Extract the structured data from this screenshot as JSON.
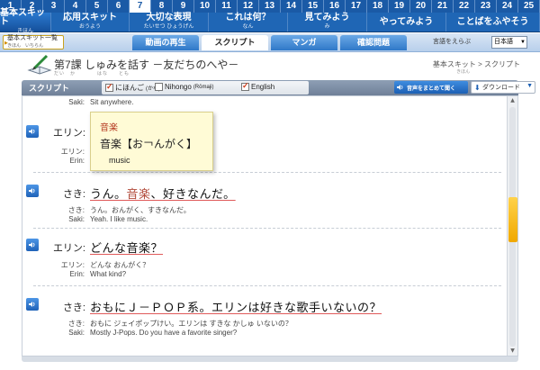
{
  "lesson_numbers": [
    "1",
    "2",
    "3",
    "4",
    "5",
    "6",
    "7",
    "8",
    "9",
    "10",
    "11",
    "12",
    "13",
    "14",
    "15",
    "16",
    "17",
    "18",
    "19",
    "20",
    "21",
    "22",
    "23",
    "24",
    "25"
  ],
  "active_lesson": "7",
  "categories": [
    {
      "label": "基本スキット",
      "sub": "きほん"
    },
    {
      "label": "応用スキット",
      "sub": "おうよう"
    },
    {
      "label": "大切な表現",
      "sub": "たいせつ ひょうげん"
    },
    {
      "label": "これは何？",
      "sub": "なん"
    },
    {
      "label": "見てみよう",
      "sub": "み"
    },
    {
      "label": "やってみよう",
      "sub": ""
    },
    {
      "label": "ことばをふやそう",
      "sub": ""
    }
  ],
  "subnav": {
    "back_label": "基本スキット一覧",
    "back_sub": "きほん　いちらん",
    "tabs": [
      {
        "label": "動画の再生"
      },
      {
        "label": "スクリプト"
      },
      {
        "label": "マンガ"
      },
      {
        "label": "確認問題"
      }
    ],
    "lang_label": "言語をえらぶ",
    "lang_value": "日本語"
  },
  "lesson": {
    "title": "第7課 しゅみを話す －友だちのへや－",
    "ruby": "だい　か　　　　はな　　とも",
    "breadcrumb": "基本スキット > スクリプト",
    "breadcrumb_ruby": "きほん"
  },
  "toolbar": {
    "label": "スクリプト",
    "check1": "にほんご",
    "check1_sub": "(かな)",
    "check2": "Nihongo",
    "check2_sub": "(Rōmaji)",
    "check3": "English",
    "audio_all": "音声をまとめて聞く",
    "download": "ダウンロード"
  },
  "script": {
    "partial_top": {
      "speaker": "Saki:",
      "text": "Sit anywhere."
    },
    "lines": [
      {
        "speaker": "エリン:",
        "text": "",
        "sub_speaker": "エリン:",
        "sub_text": "",
        "en_speaker": "Erin:",
        "en_text": ""
      },
      {
        "speaker": "さき:",
        "text_pre": "うん。",
        "text_hl": "音楽",
        "text_post": "、好きなんだ。",
        "sub_speaker": "さき:",
        "sub_text": "うん。おんがく、すきなんだ。",
        "en_speaker": "Saki:",
        "en_text": "Yeah. I like music."
      },
      {
        "speaker": "エリン:",
        "text": "どんな音楽？",
        "sub_speaker": "エリン:",
        "sub_text": "どんな おんがく？",
        "en_speaker": "Erin:",
        "en_text": "What kind?"
      },
      {
        "speaker": "さき:",
        "text": "おもにＪ－ＰＯＰ系。エリンは好きな歌手いないの？",
        "sub_speaker": "さき:",
        "sub_text": "おもに ジェイポップけい。エリンは すきな かしゅ いないの？",
        "en_speaker": "Saki:",
        "en_text": "Mostly J-Pops. Do you have a favorite singer?"
      }
    ]
  },
  "tooltip": {
    "word": "音楽",
    "reading": "音楽【お￢んがく】",
    "meaning": "music"
  },
  "colors": {
    "accent": "#1a5aa6",
    "highlight": "#b24a3a",
    "tooltip_bg": "#fffbd6"
  }
}
